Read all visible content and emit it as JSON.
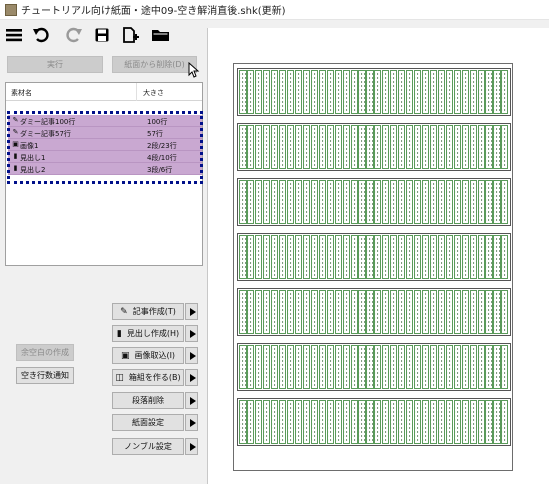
{
  "window": {
    "title": "チュートリアル向け紙面・途中09-空き解消直後.shk(更新)"
  },
  "toolbar": {
    "icons": [
      "menu-icon",
      "undo-icon",
      "redo-icon",
      "save-icon",
      "new-document-icon",
      "open-folder-icon"
    ]
  },
  "actions": {
    "run_label": "実行",
    "remove_label": "紙面から削除(D)"
  },
  "list": {
    "columns": [
      "素材名",
      "大きさ"
    ],
    "items": [
      {
        "icon": "pencil-icon",
        "name": "ダミー記事100行",
        "size": "100行"
      },
      {
        "icon": "pencil-icon",
        "name": "ダミー記事57行",
        "size": "57行"
      },
      {
        "icon": "image-icon",
        "name": "画像1",
        "size": "2段/23行"
      },
      {
        "icon": "bar-chart-icon",
        "name": "見出し1",
        "size": "4段/10行"
      },
      {
        "icon": "bar-chart-icon",
        "name": "見出し2",
        "size": "3段/6行"
      }
    ]
  },
  "side_buttons": {
    "fill_blank_label": "余空白の作成",
    "empty_lines_label": "空き行数通知",
    "create_article_label": "記事作成(T)",
    "create_heading_label": "見出し作成(H)",
    "import_image_label": "画像取込(I)",
    "make_box_label": "箱組を作る(B)",
    "delete_paragraph_label": "段落削除",
    "page_settings_label": "紙面設定",
    "nombre_settings_label": "ノンブル設定"
  },
  "page": {
    "block_count": 7,
    "columns_per_block": 34
  }
}
